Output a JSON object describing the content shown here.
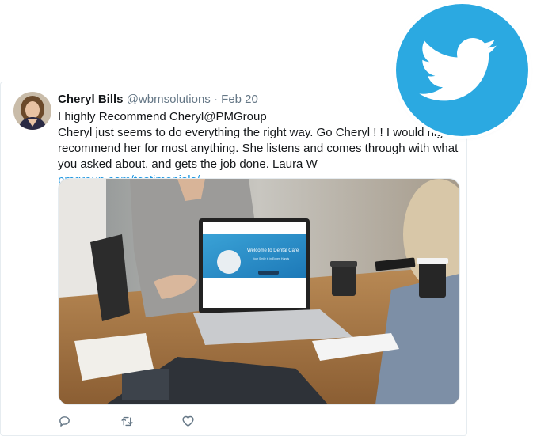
{
  "tweet": {
    "author_name": "Cheryl Bills",
    "handle": "@wbmsolutions",
    "separator": "·",
    "date": "Feb 20",
    "line1": "I highly Recommend Cheryl@PMGroup",
    "body_text": "Cheryl just seems to do everything the right way. Go Cheryl ! ! I would highly recommend her for most anything. She listens and comes through with what you asked about, and gets the job done.  Laura W ",
    "link_text": "pmgroup.com/testimonials/"
  },
  "laptop_screen": {
    "headline": "Welcome to Dental Care",
    "subtext": "Your Smile is in Expert Hands"
  },
  "icons": {
    "reply": "reply-icon",
    "retweet": "retweet-icon",
    "like": "heart-icon",
    "brand": "twitter-bird-icon"
  },
  "colors": {
    "brand": "#2ba9e1",
    "link": "#1b95e0",
    "muted": "#657786"
  }
}
